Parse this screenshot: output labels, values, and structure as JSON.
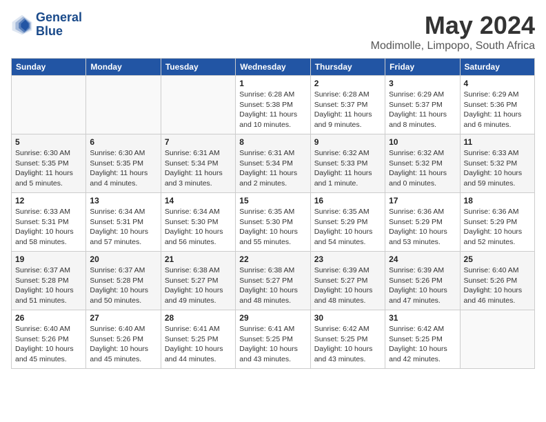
{
  "header": {
    "logo_line1": "General",
    "logo_line2": "Blue",
    "title": "May 2024",
    "subtitle": "Modimolle, Limpopo, South Africa"
  },
  "days_of_week": [
    "Sunday",
    "Monday",
    "Tuesday",
    "Wednesday",
    "Thursday",
    "Friday",
    "Saturday"
  ],
  "weeks": [
    [
      {
        "day": "",
        "info": ""
      },
      {
        "day": "",
        "info": ""
      },
      {
        "day": "",
        "info": ""
      },
      {
        "day": "1",
        "info": "Sunrise: 6:28 AM\nSunset: 5:38 PM\nDaylight: 11 hours and 10 minutes."
      },
      {
        "day": "2",
        "info": "Sunrise: 6:28 AM\nSunset: 5:37 PM\nDaylight: 11 hours and 9 minutes."
      },
      {
        "day": "3",
        "info": "Sunrise: 6:29 AM\nSunset: 5:37 PM\nDaylight: 11 hours and 8 minutes."
      },
      {
        "day": "4",
        "info": "Sunrise: 6:29 AM\nSunset: 5:36 PM\nDaylight: 11 hours and 6 minutes."
      }
    ],
    [
      {
        "day": "5",
        "info": "Sunrise: 6:30 AM\nSunset: 5:35 PM\nDaylight: 11 hours and 5 minutes."
      },
      {
        "day": "6",
        "info": "Sunrise: 6:30 AM\nSunset: 5:35 PM\nDaylight: 11 hours and 4 minutes."
      },
      {
        "day": "7",
        "info": "Sunrise: 6:31 AM\nSunset: 5:34 PM\nDaylight: 11 hours and 3 minutes."
      },
      {
        "day": "8",
        "info": "Sunrise: 6:31 AM\nSunset: 5:34 PM\nDaylight: 11 hours and 2 minutes."
      },
      {
        "day": "9",
        "info": "Sunrise: 6:32 AM\nSunset: 5:33 PM\nDaylight: 11 hours and 1 minute."
      },
      {
        "day": "10",
        "info": "Sunrise: 6:32 AM\nSunset: 5:32 PM\nDaylight: 11 hours and 0 minutes."
      },
      {
        "day": "11",
        "info": "Sunrise: 6:33 AM\nSunset: 5:32 PM\nDaylight: 10 hours and 59 minutes."
      }
    ],
    [
      {
        "day": "12",
        "info": "Sunrise: 6:33 AM\nSunset: 5:31 PM\nDaylight: 10 hours and 58 minutes."
      },
      {
        "day": "13",
        "info": "Sunrise: 6:34 AM\nSunset: 5:31 PM\nDaylight: 10 hours and 57 minutes."
      },
      {
        "day": "14",
        "info": "Sunrise: 6:34 AM\nSunset: 5:30 PM\nDaylight: 10 hours and 56 minutes."
      },
      {
        "day": "15",
        "info": "Sunrise: 6:35 AM\nSunset: 5:30 PM\nDaylight: 10 hours and 55 minutes."
      },
      {
        "day": "16",
        "info": "Sunrise: 6:35 AM\nSunset: 5:29 PM\nDaylight: 10 hours and 54 minutes."
      },
      {
        "day": "17",
        "info": "Sunrise: 6:36 AM\nSunset: 5:29 PM\nDaylight: 10 hours and 53 minutes."
      },
      {
        "day": "18",
        "info": "Sunrise: 6:36 AM\nSunset: 5:29 PM\nDaylight: 10 hours and 52 minutes."
      }
    ],
    [
      {
        "day": "19",
        "info": "Sunrise: 6:37 AM\nSunset: 5:28 PM\nDaylight: 10 hours and 51 minutes."
      },
      {
        "day": "20",
        "info": "Sunrise: 6:37 AM\nSunset: 5:28 PM\nDaylight: 10 hours and 50 minutes."
      },
      {
        "day": "21",
        "info": "Sunrise: 6:38 AM\nSunset: 5:27 PM\nDaylight: 10 hours and 49 minutes."
      },
      {
        "day": "22",
        "info": "Sunrise: 6:38 AM\nSunset: 5:27 PM\nDaylight: 10 hours and 48 minutes."
      },
      {
        "day": "23",
        "info": "Sunrise: 6:39 AM\nSunset: 5:27 PM\nDaylight: 10 hours and 48 minutes."
      },
      {
        "day": "24",
        "info": "Sunrise: 6:39 AM\nSunset: 5:26 PM\nDaylight: 10 hours and 47 minutes."
      },
      {
        "day": "25",
        "info": "Sunrise: 6:40 AM\nSunset: 5:26 PM\nDaylight: 10 hours and 46 minutes."
      }
    ],
    [
      {
        "day": "26",
        "info": "Sunrise: 6:40 AM\nSunset: 5:26 PM\nDaylight: 10 hours and 45 minutes."
      },
      {
        "day": "27",
        "info": "Sunrise: 6:40 AM\nSunset: 5:26 PM\nDaylight: 10 hours and 45 minutes."
      },
      {
        "day": "28",
        "info": "Sunrise: 6:41 AM\nSunset: 5:25 PM\nDaylight: 10 hours and 44 minutes."
      },
      {
        "day": "29",
        "info": "Sunrise: 6:41 AM\nSunset: 5:25 PM\nDaylight: 10 hours and 43 minutes."
      },
      {
        "day": "30",
        "info": "Sunrise: 6:42 AM\nSunset: 5:25 PM\nDaylight: 10 hours and 43 minutes."
      },
      {
        "day": "31",
        "info": "Sunrise: 6:42 AM\nSunset: 5:25 PM\nDaylight: 10 hours and 42 minutes."
      },
      {
        "day": "",
        "info": ""
      }
    ]
  ]
}
